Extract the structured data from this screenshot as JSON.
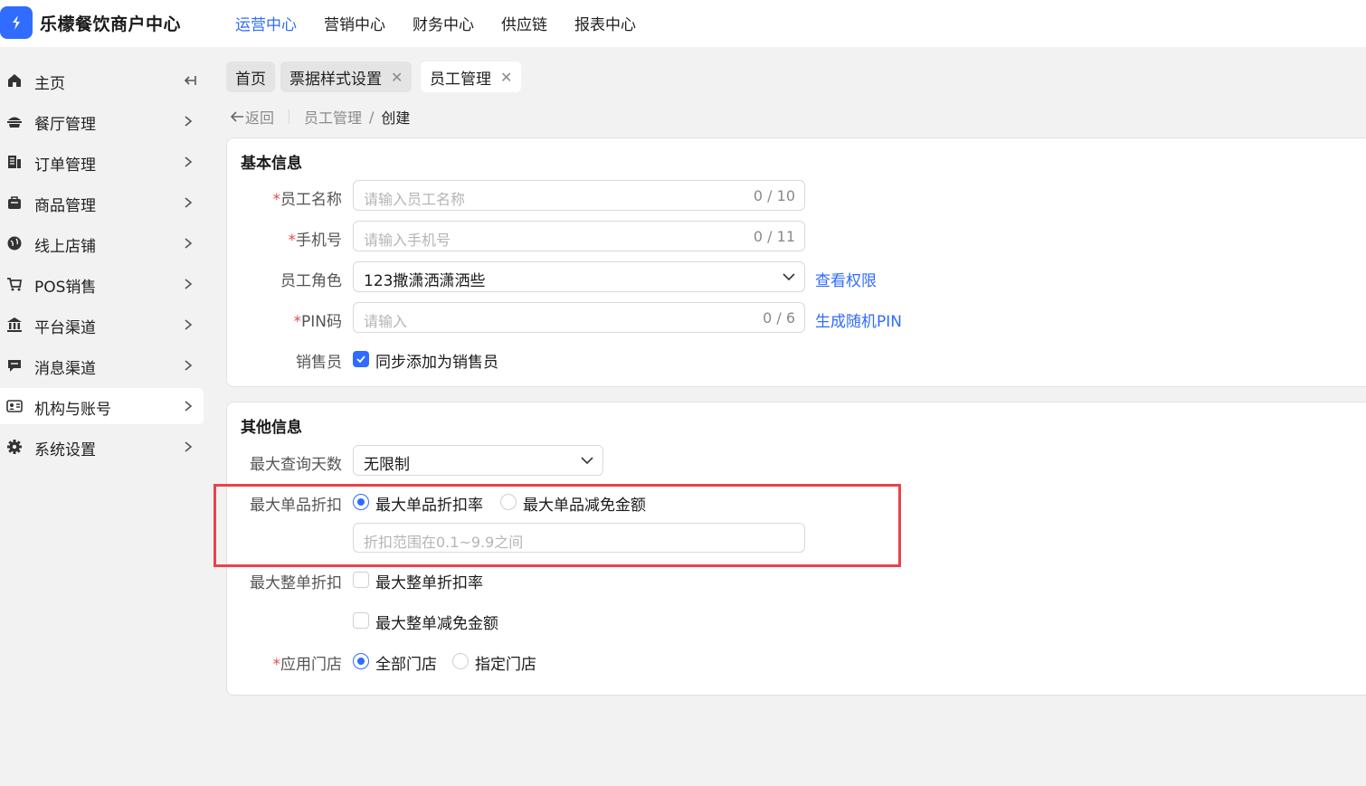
{
  "app": {
    "brand": "乐檬餐饮商户中心"
  },
  "topnav": [
    {
      "label": "运营中心",
      "active": true
    },
    {
      "label": "营销中心",
      "active": false
    },
    {
      "label": "财务中心",
      "active": false
    },
    {
      "label": "供应链",
      "active": false
    },
    {
      "label": "报表中心",
      "active": false
    }
  ],
  "sidebar": {
    "items": [
      {
        "label": "主页",
        "icon": "home-icon"
      },
      {
        "label": "餐厅管理",
        "icon": "restaurant-icon"
      },
      {
        "label": "订单管理",
        "icon": "order-icon"
      },
      {
        "label": "商品管理",
        "icon": "goods-icon"
      },
      {
        "label": "线上店铺",
        "icon": "globe-icon"
      },
      {
        "label": "POS销售",
        "icon": "cart-icon"
      },
      {
        "label": "平台渠道",
        "icon": "bank-icon"
      },
      {
        "label": "消息渠道",
        "icon": "message-icon"
      },
      {
        "label": "机构与账号",
        "icon": "account-card-icon",
        "active": true
      },
      {
        "label": "系统设置",
        "icon": "gear-icon"
      }
    ]
  },
  "tabs": [
    {
      "label": "首页",
      "closable": false
    },
    {
      "label": "票据样式设置",
      "closable": true
    },
    {
      "label": "员工管理",
      "closable": true,
      "active": true
    }
  ],
  "breadcrumb": {
    "back": "返回",
    "parent": "员工管理",
    "sep": "/",
    "current": "创建"
  },
  "basic": {
    "title": "基本信息",
    "name": {
      "label": "员工名称",
      "placeholder": "请输入员工名称",
      "count": "0 / 10"
    },
    "phone": {
      "label": "手机号",
      "placeholder": "请输入手机号",
      "count": "0 / 11"
    },
    "role": {
      "label": "员工角色",
      "value": "123撒潇洒潇洒些",
      "link": "查看权限"
    },
    "pin": {
      "label": "PIN码",
      "placeholder": "请输入",
      "count": "0 / 6",
      "link": "生成随机PIN"
    },
    "sales": {
      "label": "销售员",
      "option": "同步添加为销售员",
      "checked": true
    }
  },
  "other": {
    "title": "其他信息",
    "maxdays": {
      "label": "最大查询天数",
      "value": "无限制"
    },
    "item_discount": {
      "label": "最大单品折扣",
      "opt1": "最大单品折扣率",
      "opt2": "最大单品减免金额",
      "placeholder": "折扣范围在0.1~9.9之间"
    },
    "order_discount": {
      "label": "最大整单折扣",
      "opt1": "最大整单折扣率",
      "opt2": "最大整单减免金额"
    },
    "stores": {
      "label": "应用门店",
      "opt1": "全部门店",
      "opt2": "指定门店"
    }
  },
  "required_mark": "*",
  "colors": {
    "accent": "#2f6cff",
    "highlight": "#e8434c",
    "required": "#e34d4d"
  }
}
